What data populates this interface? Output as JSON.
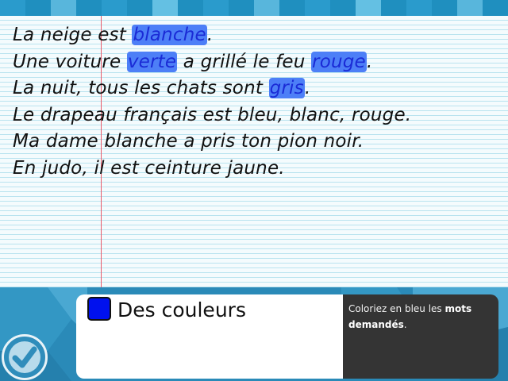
{
  "sentences": {
    "s1": {
      "a": "La neige est ",
      "h": "blanche",
      "b": "."
    },
    "s2": {
      "a": "Une voiture ",
      "h1": "verte",
      "m": " a grillé le feu ",
      "h2": "rouge",
      "b": "."
    },
    "s3": {
      "a": "La nuit, tous les chats sont ",
      "h": "gris",
      "b": "."
    },
    "s4": "Le drapeau français est bleu, blanc, rouge.",
    "s5": "Ma dame blanche a pris ton pion noir.",
    "s6": "En judo, il est ceinture jaune."
  },
  "task": {
    "title": "Des couleurs",
    "swatch_color": "#0011ee",
    "instruction_before": "Coloriez en bleu les ",
    "instruction_bold": "mots demandés",
    "instruction_after": "."
  },
  "colors": {
    "highlight": "#4d7ff7",
    "highlight_text": "#1a2bd6",
    "panel": "#2a8ab8",
    "instruction_bg": "#343434"
  },
  "icons": {
    "validate": "check-icon"
  }
}
